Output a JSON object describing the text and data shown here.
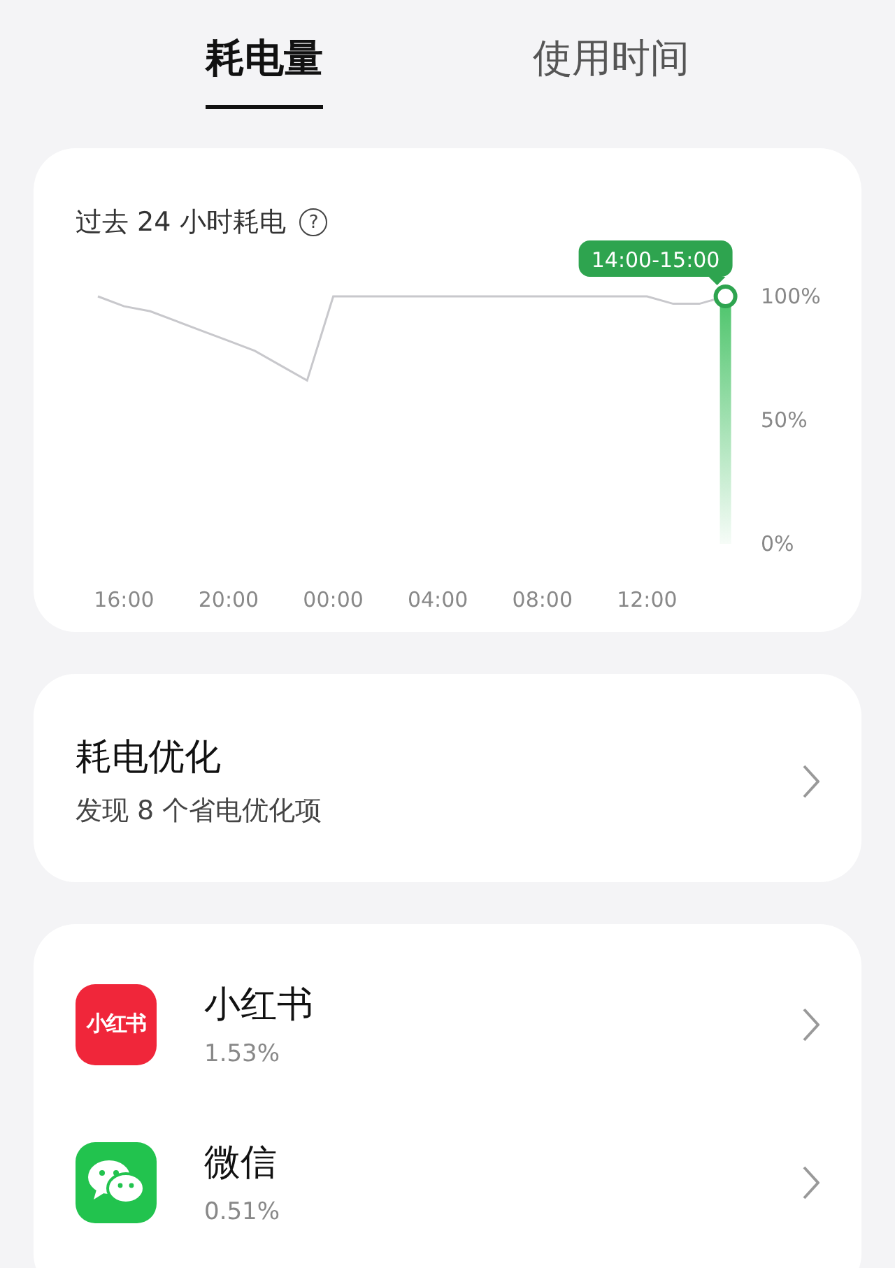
{
  "tabs": [
    {
      "label": "耗电量",
      "selected": true
    },
    {
      "label": "使用时间",
      "selected": false
    }
  ],
  "usage_card": {
    "title": "过去 24 小时耗电",
    "help_icon": "?",
    "chart_data": {
      "type": "line",
      "categories": [
        null,
        "16:00",
        null,
        null,
        null,
        "20:00",
        null,
        null,
        null,
        "00:00",
        null,
        null,
        null,
        "04:00",
        null,
        null,
        null,
        "08:00",
        null,
        null,
        null,
        "12:00",
        null,
        null,
        null
      ],
      "series": [
        {
          "color": "#c8c8cc",
          "values": [
            100,
            96,
            94,
            90,
            86,
            82,
            78,
            72,
            66,
            100,
            100,
            100,
            100,
            100,
            100,
            100,
            100,
            100,
            100,
            100,
            100,
            100,
            97,
            97,
            100
          ]
        }
      ],
      "ylim": [
        0,
        100
      ],
      "yticks": [
        {
          "value": 0,
          "label": "0%"
        },
        {
          "value": 50,
          "label": "50%"
        },
        {
          "value": 100,
          "label": "100%"
        }
      ],
      "annotations": [
        "14:00-15:00"
      ]
    }
  },
  "optimization": {
    "title": "耗电优化",
    "subtitle": "发现 8 个省电优化项"
  },
  "apps": [
    {
      "kind": "xiaohongshu",
      "icon_text": "小红书",
      "name": "小红书",
      "percent": "1.53%"
    },
    {
      "kind": "wechat",
      "name": "微信",
      "percent": "0.51%"
    }
  ]
}
